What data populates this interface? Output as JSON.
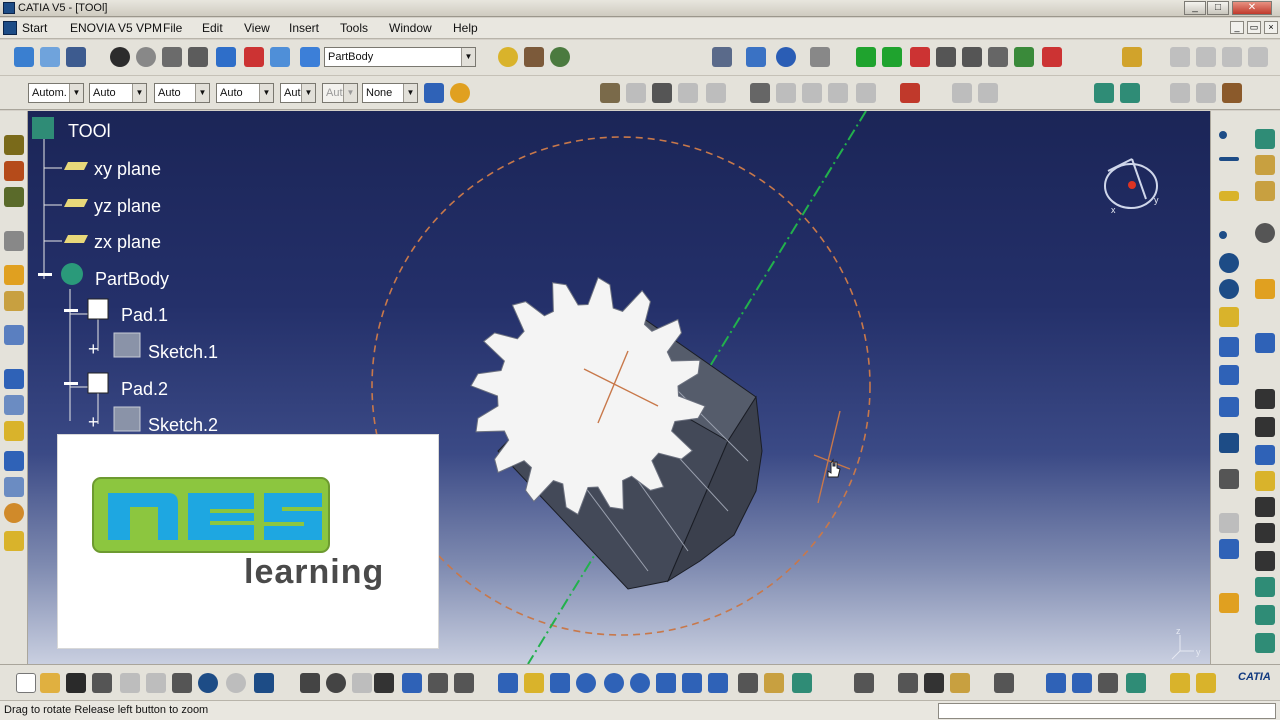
{
  "window": {
    "title": "CATIA V5 - [TOOl]",
    "min": "_",
    "max": "□",
    "close": "✕"
  },
  "menu": {
    "items": [
      {
        "label": "Start"
      },
      {
        "label": "ENOVIA V5 VPM"
      },
      {
        "label": "File"
      },
      {
        "label": "Edit"
      },
      {
        "label": "View"
      },
      {
        "label": "Insert"
      },
      {
        "label": "Tools"
      },
      {
        "label": "Window"
      },
      {
        "label": "Help"
      }
    ]
  },
  "toolbar": {
    "body_select": "PartBody",
    "graphic_props": [
      "Autom.",
      "Auto",
      "Auto",
      "Auto",
      "Aut",
      "Aut",
      "None"
    ]
  },
  "tree": {
    "root": "TOOl",
    "planes": [
      "xy plane",
      "yz plane",
      "zx plane"
    ],
    "body": "PartBody",
    "features": [
      {
        "name": "Pad.1",
        "child": "Sketch.1"
      },
      {
        "name": "Pad.2",
        "child": "Sketch.2"
      }
    ]
  },
  "logo": {
    "letters": "nes",
    "word": "learning",
    "green": "#8cc63f",
    "blue": "#1ea7e1"
  },
  "status": {
    "message": "Drag to rotate  Release left button to zoom"
  },
  "compass": {
    "x": "x",
    "y": "y",
    "z": "z"
  },
  "brand": "CATIA",
  "colors": {
    "viewport_top": "#1b2557",
    "viewport_bottom": "#c9cfe0",
    "gear_face": "#f4f4f4",
    "gear_side": "#4f5562",
    "axis": "#22b14c",
    "construction": "#c8784a"
  }
}
